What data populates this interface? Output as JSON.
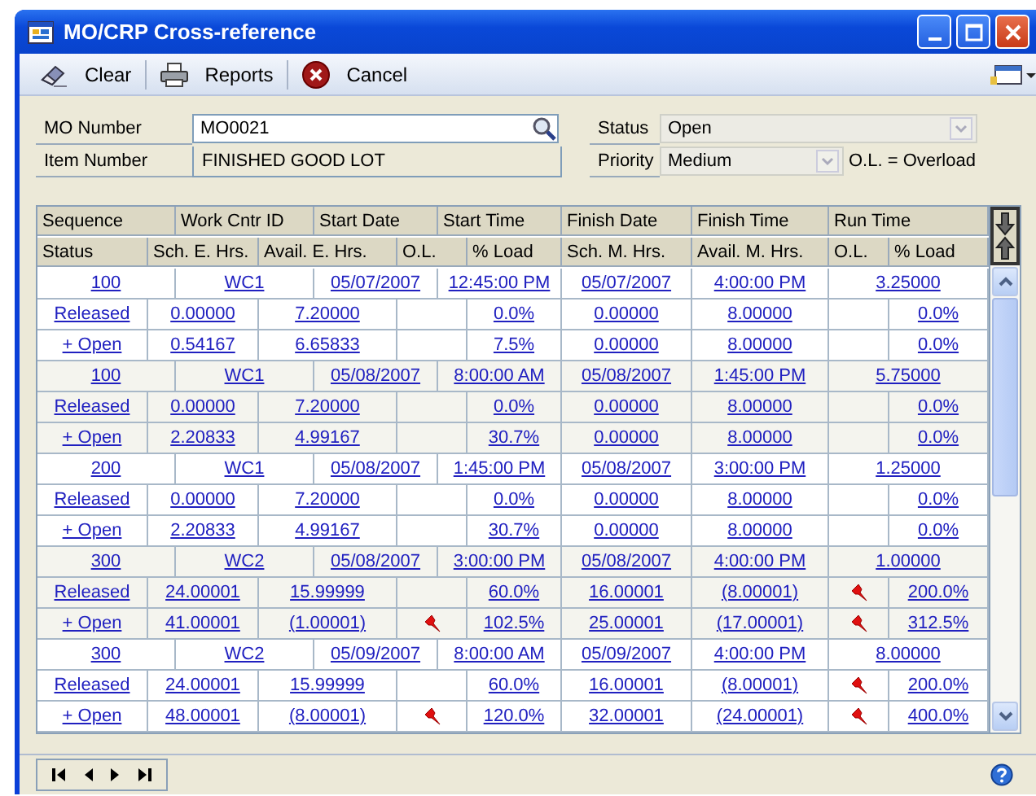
{
  "window": {
    "title": "MO/CRP Cross-reference"
  },
  "toolbar": [
    {
      "label": "Clear",
      "kind": "clear"
    },
    {
      "label": "Reports",
      "kind": "print"
    },
    {
      "label": "Cancel",
      "kind": "cancel"
    }
  ],
  "form": {
    "mo_number_label": "MO Number",
    "mo_number": "MO0021",
    "item_number_label": "Item Number",
    "item_number": "FINISHED GOOD LOT",
    "status_label": "Status",
    "status": "Open",
    "priority_label": "Priority",
    "priority": "Medium",
    "legend": "O.L. = Overload"
  },
  "table": {
    "header_row_1": [
      "Sequence",
      "Work Cntr  ID",
      "Start Date",
      "Start Time",
      "Finish Date",
      "Finish Time",
      "Run Time"
    ],
    "header_row_2": [
      "Status",
      "Sch. E. Hrs.",
      "Avail. E. Hrs.",
      "O.L.",
      "% Load",
      "Sch. M. Hrs.",
      "Avail. M. Hrs.",
      "O.L.",
      "% Load"
    ],
    "groups": [
      {
        "sequence": "100",
        "work_center": "WC1",
        "start_date": "05/07/2007",
        "start_time": "12:45:00  PM",
        "finish_date": "05/07/2007",
        "finish_time": "4:00:00  PM",
        "run_time": "3.25000",
        "loads": [
          {
            "status": "Released",
            "sch_e": "0.00000",
            "avail_e": "7.20000",
            "e_overload": false,
            "e_load": "0.0%",
            "sch_m": "0.00000",
            "avail_m": "8.00000",
            "m_overload": false,
            "m_load": "0.0%"
          },
          {
            "status": "+ Open",
            "sch_e": "0.54167",
            "avail_e": "6.65833",
            "e_overload": false,
            "e_load": "7.5%",
            "sch_m": "0.00000",
            "avail_m": "8.00000",
            "m_overload": false,
            "m_load": "0.0%"
          }
        ]
      },
      {
        "sequence": "100",
        "work_center": "WC1",
        "start_date": "05/08/2007",
        "start_time": "8:00:00  AM",
        "finish_date": "05/08/2007",
        "finish_time": "1:45:00  PM",
        "run_time": "5.75000",
        "loads": [
          {
            "status": "Released",
            "sch_e": "0.00000",
            "avail_e": "7.20000",
            "e_overload": false,
            "e_load": "0.0%",
            "sch_m": "0.00000",
            "avail_m": "8.00000",
            "m_overload": false,
            "m_load": "0.0%"
          },
          {
            "status": "+ Open",
            "sch_e": "2.20833",
            "avail_e": "4.99167",
            "e_overload": false,
            "e_load": "30.7%",
            "sch_m": "0.00000",
            "avail_m": "8.00000",
            "m_overload": false,
            "m_load": "0.0%"
          }
        ]
      },
      {
        "sequence": "200",
        "work_center": "WC1",
        "start_date": "05/08/2007",
        "start_time": "1:45:00  PM",
        "finish_date": "05/08/2007",
        "finish_time": "3:00:00  PM",
        "run_time": "1.25000",
        "loads": [
          {
            "status": "Released",
            "sch_e": "0.00000",
            "avail_e": "7.20000",
            "e_overload": false,
            "e_load": "0.0%",
            "sch_m": "0.00000",
            "avail_m": "8.00000",
            "m_overload": false,
            "m_load": "0.0%"
          },
          {
            "status": "+ Open",
            "sch_e": "2.20833",
            "avail_e": "4.99167",
            "e_overload": false,
            "e_load": "30.7%",
            "sch_m": "0.00000",
            "avail_m": "8.00000",
            "m_overload": false,
            "m_load": "0.0%"
          }
        ]
      },
      {
        "sequence": "300",
        "work_center": "WC2",
        "start_date": "05/08/2007",
        "start_time": "3:00:00  PM",
        "finish_date": "05/08/2007",
        "finish_time": "4:00:00  PM",
        "run_time": "1.00000",
        "loads": [
          {
            "status": "Released",
            "sch_e": "24.00001",
            "avail_e": "15.99999",
            "e_overload": false,
            "e_load": "60.0%",
            "sch_m": "16.00001",
            "avail_m": "(8.00001)",
            "m_overload": true,
            "m_load": "200.0%"
          },
          {
            "status": "+ Open",
            "sch_e": "41.00001",
            "avail_e": "(1.00001)",
            "e_overload": true,
            "e_load": "102.5%",
            "sch_m": "25.00001",
            "avail_m": "(17.00001)",
            "m_overload": true,
            "m_load": "312.5%"
          }
        ]
      },
      {
        "sequence": "300",
        "work_center": "WC2",
        "start_date": "05/09/2007",
        "start_time": "8:00:00  AM",
        "finish_date": "05/09/2007",
        "finish_time": "4:00:00  PM",
        "run_time": "8.00000",
        "loads": [
          {
            "status": "Released",
            "sch_e": "24.00001",
            "avail_e": "15.99999",
            "e_overload": false,
            "e_load": "60.0%",
            "sch_m": "16.00001",
            "avail_m": "(8.00001)",
            "m_overload": true,
            "m_load": "200.0%"
          },
          {
            "status": "+ Open",
            "sch_e": "48.00001",
            "avail_e": "(8.00001)",
            "e_overload": true,
            "e_load": "120.0%",
            "sch_m": "32.00001",
            "avail_m": "(24.00001)",
            "m_overload": true,
            "m_load": "400.0%"
          }
        ]
      }
    ]
  }
}
